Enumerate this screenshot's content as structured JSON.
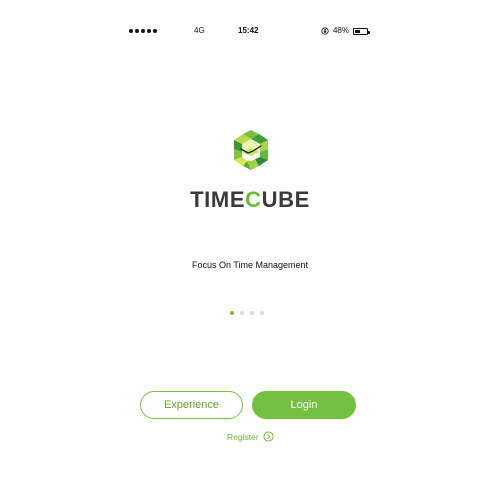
{
  "status_bar": {
    "network": "4G",
    "time": "15:42",
    "battery": "48%",
    "battery_level": 0.48
  },
  "brand": {
    "title_prefix": "TIME",
    "title_accent": "C",
    "title_suffix": "UBE",
    "tagline": "Focus On Time Management",
    "accent_color": "#6bbc37"
  },
  "carousel": {
    "active_index": 0,
    "total": 4
  },
  "actions": {
    "experience_label": "Experience",
    "login_label": "Login",
    "register_label": "Register"
  },
  "icons": {
    "lock": "lock-icon",
    "battery": "battery-icon",
    "logo": "timecube-logo",
    "register_arrow": "chevron-right-circle-icon"
  }
}
